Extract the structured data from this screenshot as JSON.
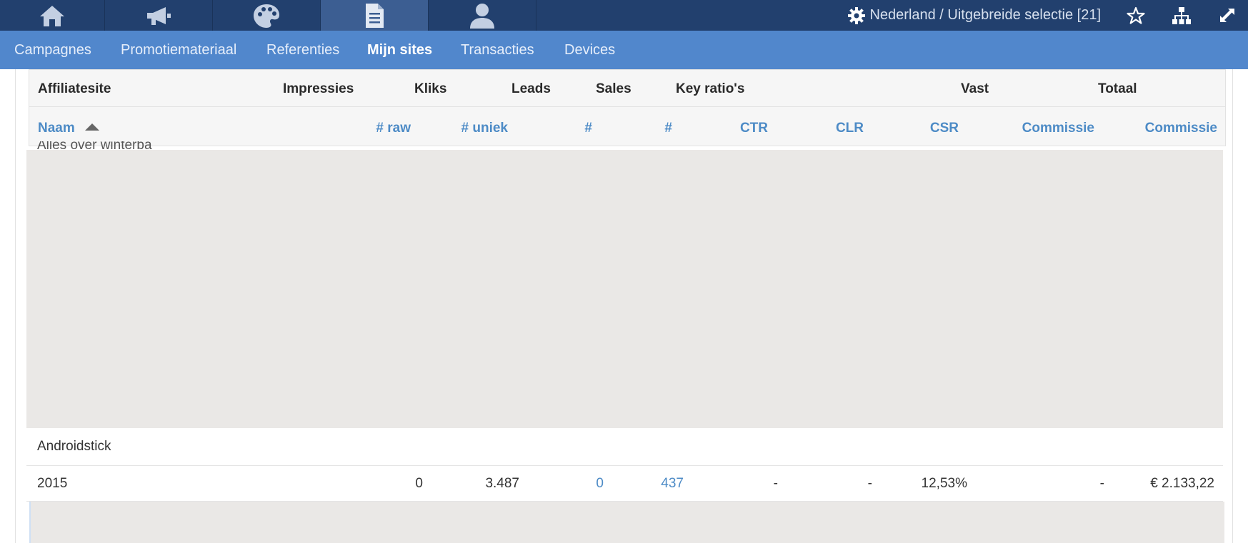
{
  "topbar": {
    "tabs": [
      {
        "name": "home-icon",
        "active": false
      },
      {
        "name": "megaphone-icon",
        "active": false
      },
      {
        "name": "palette-icon",
        "active": false
      },
      {
        "name": "document-icon",
        "active": true
      },
      {
        "name": "user-icon",
        "active": false
      }
    ],
    "region_label": "Nederland / Uitgebreide selectie [21]",
    "right_icons": [
      "gear-icon",
      "star-icon",
      "sitemap-icon",
      "expand-icon"
    ]
  },
  "subnav": {
    "items": [
      "Campagnes",
      "Promotiemateriaal",
      "Referenties",
      "Mijn sites",
      "Transacties",
      "Devices"
    ],
    "active": "Mijn sites"
  },
  "table": {
    "group_headers": [
      "Affiliatesite",
      "Impressies",
      "Kliks",
      "Leads",
      "Sales",
      "Key ratio's",
      "Vast",
      "Totaal"
    ],
    "column_headers": [
      "Naam",
      "# raw",
      "# uniek",
      "#",
      "#",
      "CTR",
      "CLR",
      "CSR",
      "Commissie",
      "Commissie"
    ],
    "peek_text": "Alles over winterba",
    "site_name": "Androidstick",
    "row": {
      "naam": "2015",
      "raw": "0",
      "uniek": "3.487",
      "leads": "0",
      "sales": "437",
      "ctr": "-",
      "clr": "-",
      "csr": "12,53%",
      "vast": "-",
      "totaal": "€ 2.133,22"
    }
  },
  "colors": {
    "topbar": "#22406e",
    "topbar_active": "#3c5e92",
    "subnav": "#5187cc",
    "header_link": "#4d8bc6",
    "placeholder": "#eae8e6"
  }
}
